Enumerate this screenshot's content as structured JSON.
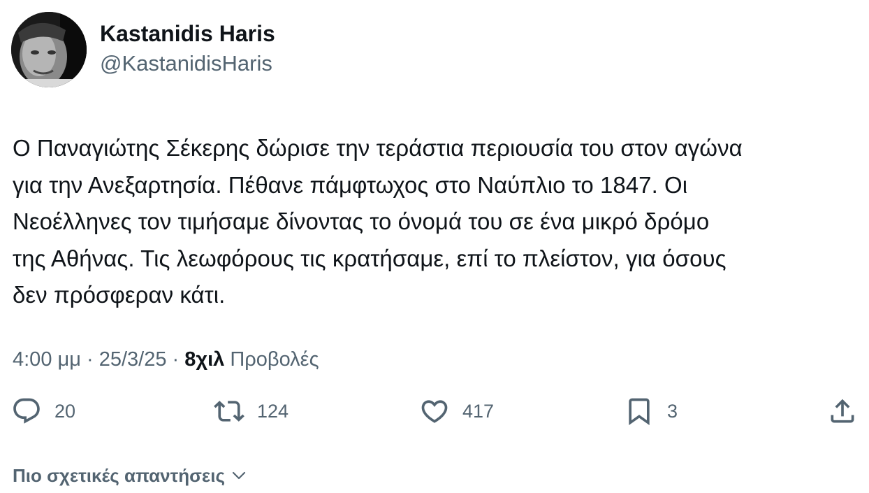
{
  "author": {
    "display_name": "Kastanidis Haris",
    "handle": "@KastanidisHaris"
  },
  "tweet": {
    "lines": [
      "Ο Παναγιώτης Σέκερης δώρισε την τεράστια περιουσία του στον αγώνα",
      "για την Ανεξαρτησία. Πέθανε πάμφτωχος στο Ναύπλιο το 1847. Οι",
      "Νεοέλληνες τον τιμήσαμε δίνοντας το όνομά του σε ένα μικρό δρόμο",
      "της Αθήνας. Τις λεωφόρους τις κρατήσαμε, επί το πλείστον, για όσους",
      "δεν πρόσφεραν κάτι."
    ],
    "time": "4:00 μμ",
    "date": "25/3/25",
    "separator": "·",
    "views_count": "8χιλ",
    "views_label": "Προβολές"
  },
  "actions": {
    "reply": {
      "icon": "reply-icon",
      "count": "20"
    },
    "retweet": {
      "icon": "retweet-icon",
      "count": "124"
    },
    "like": {
      "icon": "heart-icon",
      "count": "417"
    },
    "bookmark": {
      "icon": "bookmark-icon",
      "count": "3"
    },
    "share": {
      "icon": "share-icon"
    }
  },
  "replies_filter": {
    "label": "Πιο σχετικές απαντήσεις",
    "icon": "chevron-down-icon"
  },
  "colors": {
    "text_primary": "#0f1419",
    "text_secondary": "#536471",
    "background": "#ffffff"
  }
}
